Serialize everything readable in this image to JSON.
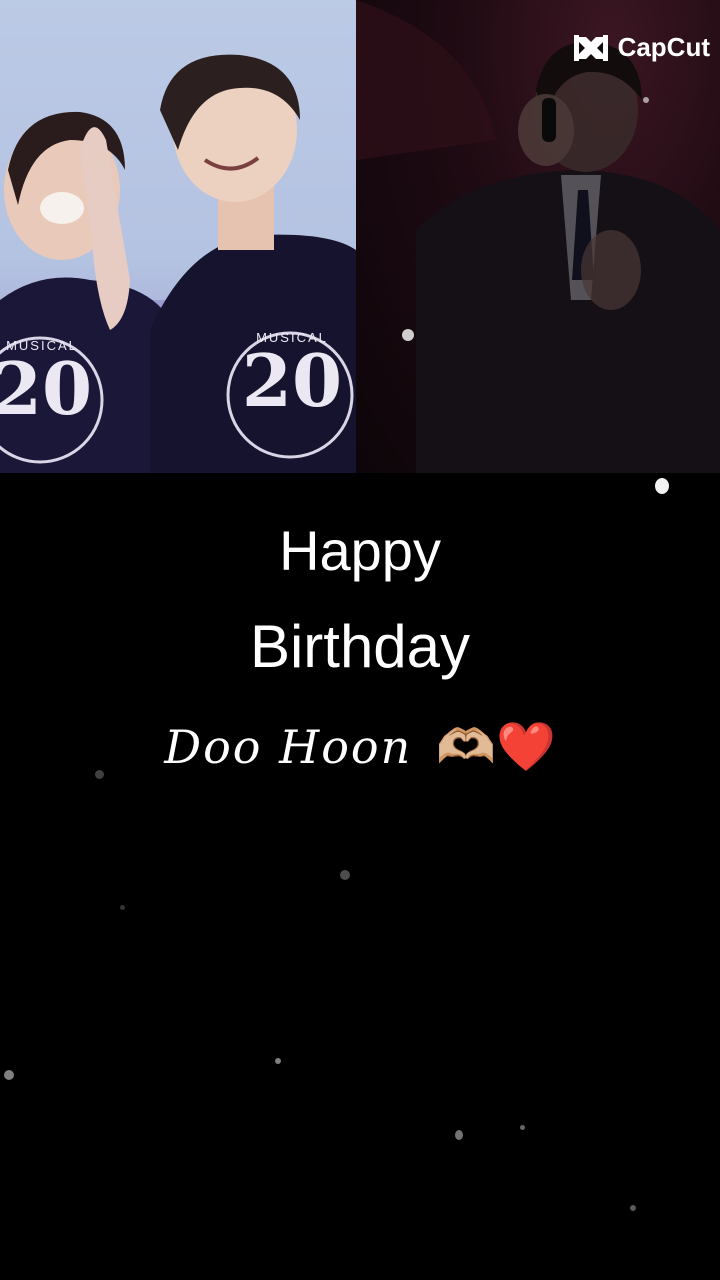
{
  "watermark": {
    "brand": "CapCut",
    "icon": "capcut-logo-icon"
  },
  "left_photo": {
    "shirt_text_1": "MUSICAL",
    "shirt_number_1": "20",
    "shirt_text_2": "MUSICAL",
    "shirt_number_2": "20"
  },
  "right_photo": {
    "icon": "singer-microphone-image"
  },
  "message": {
    "line1": "Happy",
    "line2": "Birthday",
    "signature": "Doo Hoon",
    "emoji": "🫶🏼❤️"
  },
  "colors": {
    "background": "#000000",
    "text": "#ffffff"
  }
}
